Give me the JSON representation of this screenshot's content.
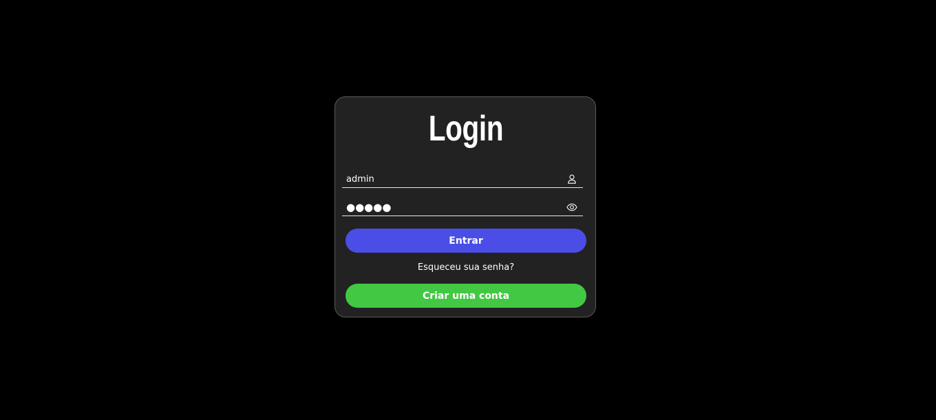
{
  "login_form": {
    "title": "Login",
    "username": {
      "value": "admin",
      "icon": "user-icon"
    },
    "password": {
      "value": "●●●●●",
      "icon": "eye-icon"
    },
    "submit_label": "Entrar",
    "forgot_label": "Esqueceu sua senha?",
    "signup_label": "Criar uma conta"
  },
  "colors": {
    "background": "#000000",
    "card": "#222222",
    "primary": "#4b4ee6",
    "success": "#42c843"
  }
}
